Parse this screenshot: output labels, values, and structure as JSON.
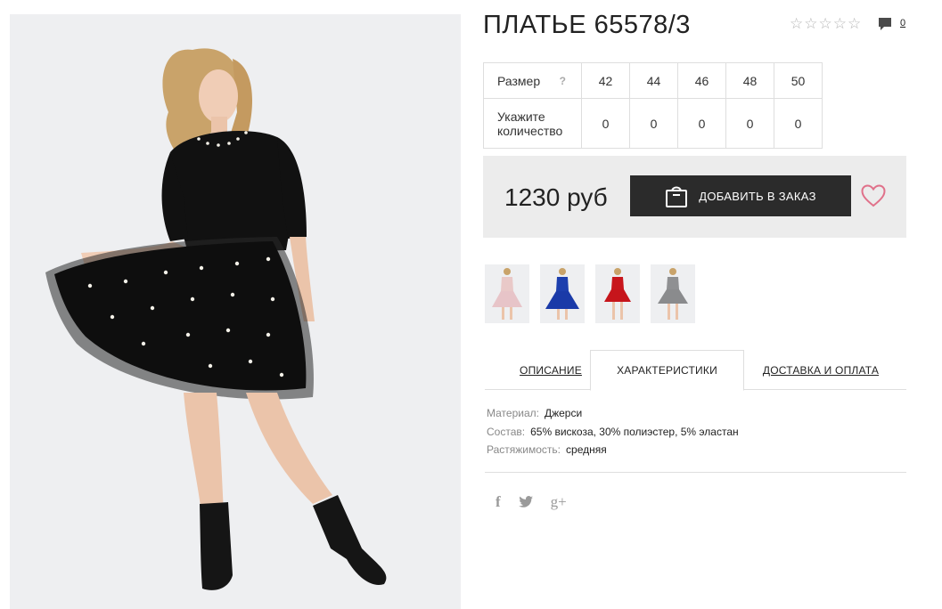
{
  "product": {
    "title": "ПЛАТЬЕ 65578/3",
    "rating": {
      "stars_filled": 0,
      "stars_total": 5
    },
    "comments_count": "0"
  },
  "sizes": {
    "size_header": "Размер",
    "help_mark": "?",
    "quantity_label": "Укажите количество",
    "items": [
      {
        "size": "42",
        "qty": "0"
      },
      {
        "size": "44",
        "qty": "0"
      },
      {
        "size": "46",
        "qty": "0"
      },
      {
        "size": "48",
        "qty": "0"
      },
      {
        "size": "50",
        "qty": "0"
      }
    ]
  },
  "purchase": {
    "price": "1230 руб",
    "add_button": "ДОБАВИТЬ В ЗАКАЗ"
  },
  "thumbnails": [
    {
      "color_name": "pink",
      "dress": "#e9c9c8",
      "skirt": "#e7c4c8"
    },
    {
      "color_name": "blue",
      "dress": "#1d3fae",
      "skirt": "#1a3aa8"
    },
    {
      "color_name": "red",
      "dress": "#c8161c",
      "skirt": "#c6151b"
    },
    {
      "color_name": "grey",
      "dress": "#8f9092",
      "skirt": "#8a8b8d"
    }
  ],
  "tabs": [
    {
      "label": "ОПИСАНИЕ",
      "active": false
    },
    {
      "label": "ХАРАКТЕРИСТИКИ",
      "active": true
    },
    {
      "label": "ДОСТАВКА И ОПЛАТА",
      "active": false
    }
  ],
  "characteristics": [
    {
      "key": "Материал:",
      "value": "Джерси"
    },
    {
      "key": "Состав:",
      "value": "65% вискоза, 30% полиэстер, 5% эластан"
    },
    {
      "key": "Растяжимость:",
      "value": "средняя"
    }
  ],
  "social": [
    {
      "name": "facebook-icon",
      "glyph": "f"
    },
    {
      "name": "twitter-icon",
      "glyph": ""
    },
    {
      "name": "google-plus-icon",
      "glyph": "g+"
    }
  ],
  "colors": {
    "accent_heart": "#e0718a",
    "button_bg": "#2b2b2b",
    "price_bar_bg": "#ececec",
    "photo_bg": "#eeeff1"
  }
}
